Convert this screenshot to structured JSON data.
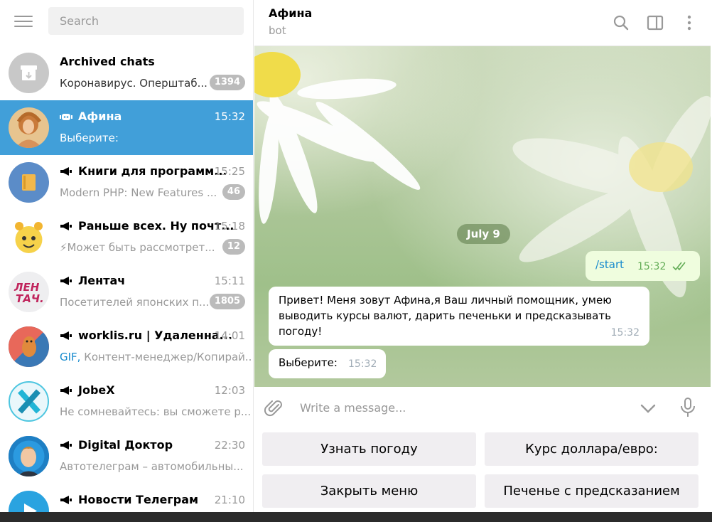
{
  "sidebar": {
    "search_placeholder": "Search",
    "chats": [
      {
        "title": "Archived chats",
        "time": "",
        "preview": "Коронавирус. Оперштаб...",
        "preview_highlight": "",
        "badge": "1394"
      },
      {
        "title": "Афина",
        "time": "15:32",
        "preview": "Выберите:",
        "preview_highlight": "",
        "badge": ""
      },
      {
        "title": "Книги для программ...",
        "time": "15:25",
        "preview": "Modern PHP: New Features ...",
        "preview_highlight": "",
        "badge": "46"
      },
      {
        "title": "Раньше всех. Ну почт...",
        "time": "15:18",
        "preview": "⚡Может быть рассмотрет...",
        "preview_highlight": "",
        "badge": "12"
      },
      {
        "title": "Лентач",
        "time": "15:11",
        "preview": "Посетителей японских п...",
        "preview_highlight": "",
        "badge": "1805"
      },
      {
        "title": "worklis.ru | Удаленна...",
        "time": "14:01",
        "preview": "Контент-менеджер/Копирай...",
        "preview_highlight": "GIF,",
        "badge": ""
      },
      {
        "title": "JobeX",
        "time": "12:03",
        "preview": "Не сомневайтесь: вы сможете р...",
        "preview_highlight": "",
        "badge": ""
      },
      {
        "title": "Digital Доктор",
        "time": "22:30",
        "preview": "Автотелеграм – автомобильны...",
        "preview_highlight": "",
        "badge": ""
      },
      {
        "title": "Новости Телеграм",
        "time": "21:10",
        "preview": "",
        "preview_highlight": "",
        "badge": ""
      }
    ],
    "avatar_text": {
      "lentach": "ЛЕН ТАЧ."
    }
  },
  "chat": {
    "title": "Афина",
    "subtitle": "bot",
    "date_pill": "July 9",
    "messages": [
      {
        "text": "/start",
        "time": "15:32"
      },
      {
        "text": "Привет! Меня зовут Афина,я Ваш личный помощник, умею выводить курсы валют, дарить печеньки и предсказывать погоду!",
        "time": "15:32"
      },
      {
        "text": "Выберите:",
        "time": "15:32"
      }
    ],
    "composer_placeholder": "Write a message...",
    "keyboard": [
      "Узнать погоду",
      "Курс доллара/евро:",
      "Закрыть меню",
      "Печенье с предсказанием"
    ]
  },
  "colors": {
    "accent": "#419fd9",
    "badge": "#bbbbbb",
    "checks": "#62ac55"
  },
  "icons": [
    "menu-icon",
    "archive-icon",
    "bot-icon",
    "megaphone-icon",
    "search-icon",
    "sidebar-toggle-icon",
    "more-icon",
    "attach-icon",
    "chevron-down-icon",
    "microphone-icon",
    "double-check-icon"
  ]
}
